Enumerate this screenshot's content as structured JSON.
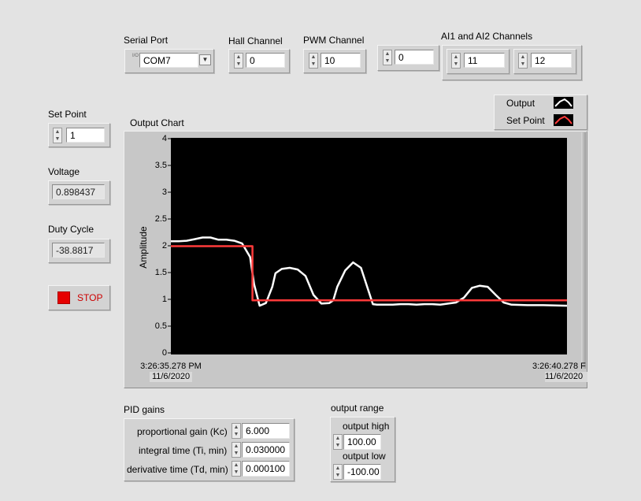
{
  "serial_port": {
    "label": "Serial Port",
    "value": "COM7",
    "io_glyph": "I/O"
  },
  "hall_channel": {
    "label": "Hall Channel",
    "value": "0"
  },
  "pwm_channel": {
    "label": "PWM Channel",
    "value": "10"
  },
  "extra_channel": {
    "value": "0"
  },
  "ai_channels": {
    "label": "AI1 and AI2 Channels",
    "ai1": "11",
    "ai2": "12"
  },
  "set_point": {
    "label": "Set Point",
    "value": "1"
  },
  "voltage": {
    "label": "Voltage",
    "value": "0.898437"
  },
  "duty_cycle": {
    "label": "Duty Cycle",
    "value": "-38.8817"
  },
  "stop_button": {
    "label": "STOP"
  },
  "chart": {
    "label": "Output Chart",
    "ylabel": "Amplitude",
    "background": "#000000",
    "x_start": {
      "time": "3:26:35.278 PM",
      "date": "11/6/2020"
    },
    "x_end": {
      "time": "3:26:40.278 F",
      "date": "11/6/2020"
    },
    "legend": [
      {
        "name": "Output",
        "color": "#ffffff"
      },
      {
        "name": "Set Point",
        "color": "#ff3a3a"
      }
    ]
  },
  "chart_data": {
    "type": "line",
    "title": "Output Chart",
    "xlabel": "",
    "ylabel": "Amplitude",
    "xlim": [
      0,
      5
    ],
    "ylim": [
      0,
      4
    ],
    "y_ticks": [
      "0",
      "0.5",
      "1",
      "1.5",
      "2",
      "2.5",
      "3",
      "3.5",
      "4"
    ],
    "x_tick_labels": [
      "3:26:35.278 PM\n11/6/2020",
      "3:26:40.278 F\n11/6/2020"
    ],
    "grid": false,
    "legend": "top-right",
    "series": [
      {
        "name": "Output",
        "color": "#ffffff",
        "x": [
          0,
          0.1,
          0.2,
          0.3,
          0.4,
          0.5,
          0.6,
          0.7,
          0.8,
          0.9,
          1.0,
          1.05,
          1.12,
          1.2,
          1.28,
          1.32,
          1.4,
          1.5,
          1.6,
          1.7,
          1.8,
          1.9,
          2.0,
          2.05,
          2.1,
          2.2,
          2.3,
          2.4,
          2.5,
          2.55,
          2.6,
          2.7,
          2.8,
          2.9,
          3.0,
          3.1,
          3.2,
          3.3,
          3.4,
          3.5,
          3.6,
          3.7,
          3.8,
          3.9,
          4.0,
          4.1,
          4.2,
          4.3,
          4.5,
          4.7,
          5.0
        ],
        "y": [
          2.09,
          2.09,
          2.1,
          2.13,
          2.16,
          2.16,
          2.12,
          2.12,
          2.1,
          2.05,
          1.8,
          1.3,
          0.9,
          0.95,
          1.25,
          1.5,
          1.58,
          1.6,
          1.57,
          1.45,
          1.1,
          0.94,
          0.95,
          1.0,
          1.25,
          1.55,
          1.7,
          1.6,
          1.15,
          0.93,
          0.92,
          0.92,
          0.92,
          0.93,
          0.93,
          0.92,
          0.93,
          0.93,
          0.92,
          0.94,
          0.96,
          1.05,
          1.23,
          1.27,
          1.25,
          1.1,
          0.96,
          0.92,
          0.91,
          0.91,
          0.9
        ]
      },
      {
        "name": "Set Point",
        "color": "#ff3a3a",
        "x": [
          0,
          1.03,
          1.03,
          5.0
        ],
        "y": [
          2,
          2,
          1,
          1
        ]
      }
    ]
  },
  "pid_gains": {
    "label": "PID gains",
    "kc_label": "proportional gain (Kc)",
    "kc": "6.000",
    "ti_label": "integral time (Ti, min)",
    "ti": "0.030000",
    "td_label": "derivative time (Td, min)",
    "td": "0.000100"
  },
  "output_range": {
    "label": "output range",
    "high_label": "output high",
    "high": "100.00",
    "low_label": "output low",
    "low": "-100.00"
  }
}
